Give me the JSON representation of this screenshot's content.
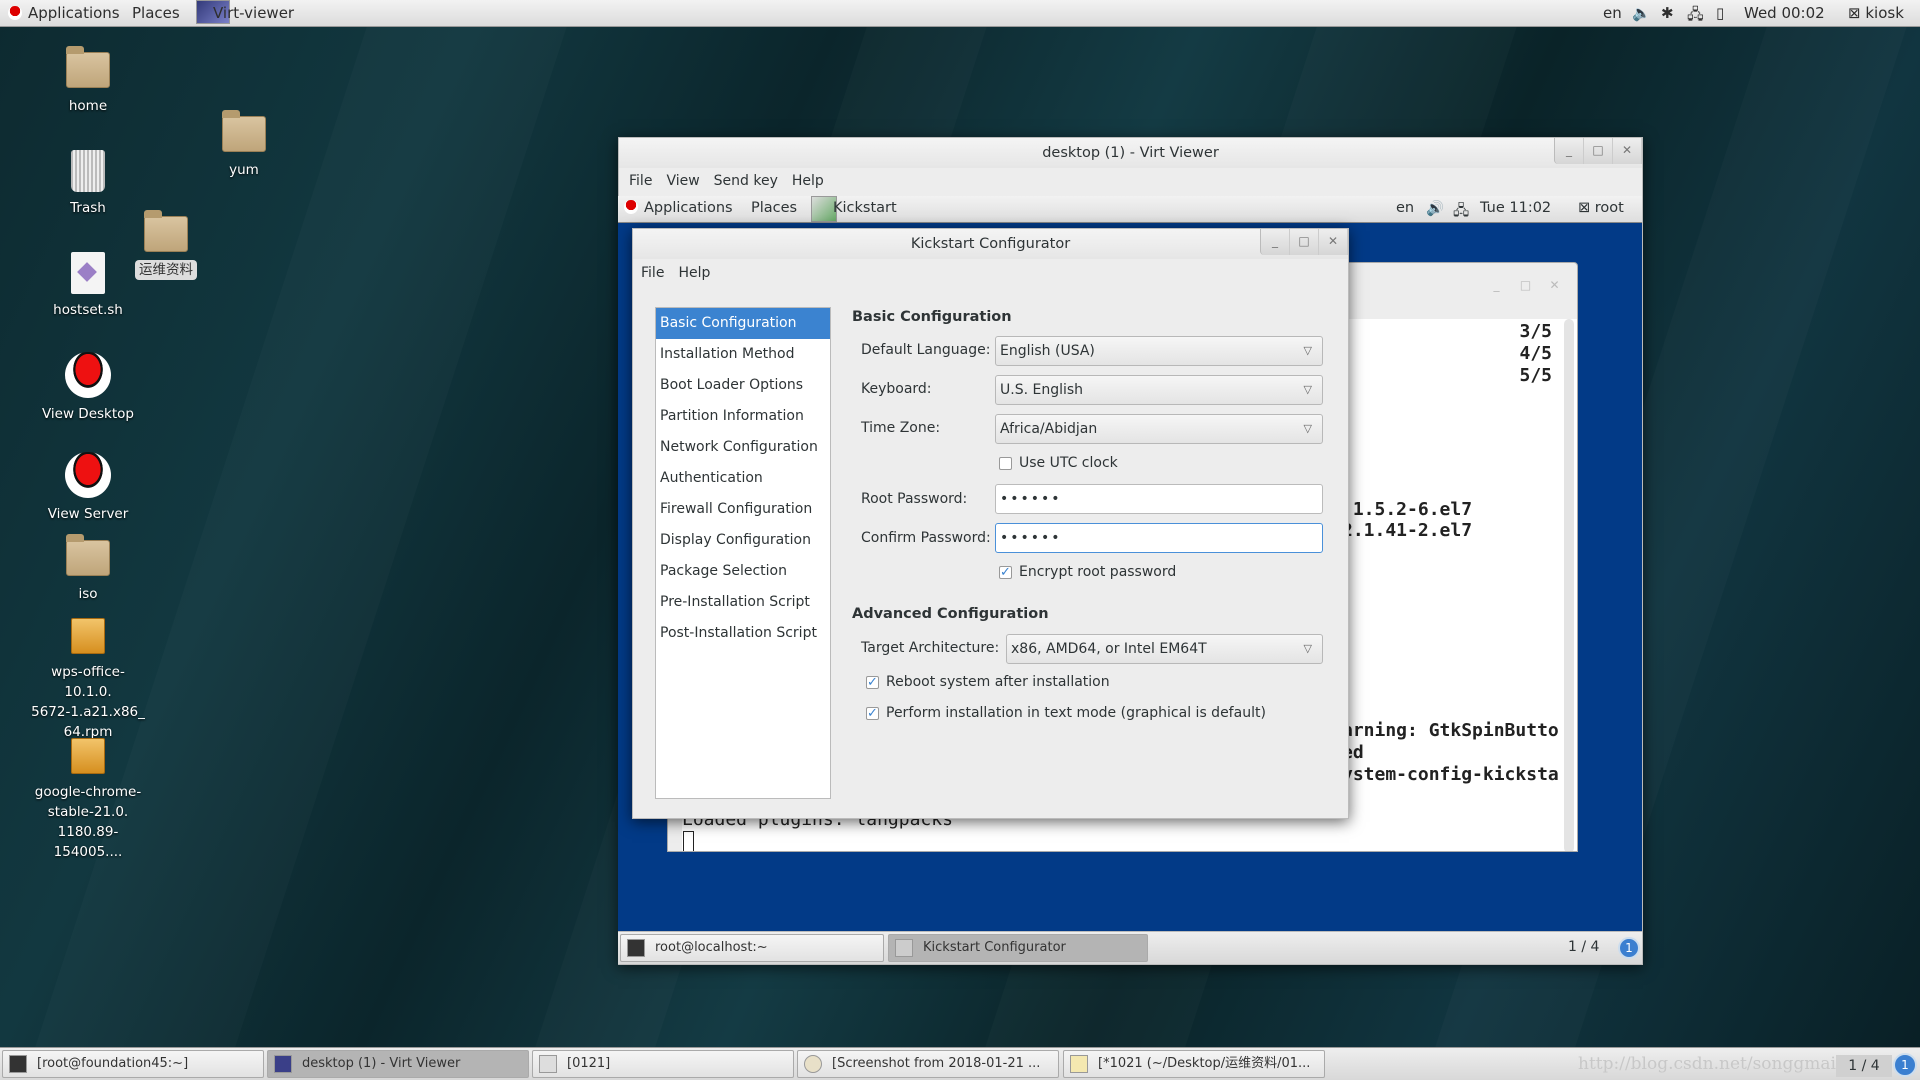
{
  "top_panel": {
    "applications": "Applications",
    "places": "Places",
    "app": "Virt-viewer",
    "lang": "en",
    "clock": "Wed 00:02",
    "user": "kiosk"
  },
  "desktop_icons": [
    {
      "label": "home",
      "type": "home-folder"
    },
    {
      "label": "Trash",
      "type": "trash"
    },
    {
      "label": "hostset.sh",
      "type": "script"
    },
    {
      "label": "View Desktop",
      "type": "redhat"
    },
    {
      "label": "View Server",
      "type": "redhat"
    },
    {
      "label": "iso",
      "type": "locked-folder"
    },
    {
      "label": "wps-office-10.1.0.\n5672-1.a21.x86_\n64.rpm",
      "type": "package"
    },
    {
      "label": "google-chrome-\nstable-21.0.\n1180.89-154005....",
      "type": "package"
    },
    {
      "label": "yum",
      "type": "folder"
    },
    {
      "label": "运维资料",
      "type": "folder"
    }
  ],
  "virt_viewer": {
    "title": "desktop (1) - Virt Viewer",
    "menu": [
      "File",
      "View",
      "Send key",
      "Help"
    ]
  },
  "guest_panel": {
    "applications": "Applications",
    "places": "Places",
    "app": "Kickstart",
    "lang": "en",
    "clock": "Tue 11:02",
    "user": "root"
  },
  "terminal": {
    "lines_right": [
      "3/5",
      "4/5",
      "5/5"
    ],
    "fragments": [
      ":1.5.2-6.el7",
      "2.1.41-2.el7",
      "arning: GtkSpinButto",
      "ed",
      "ystem-config-kicksta"
    ],
    "last_line": "Loaded plugins: langpacks"
  },
  "kickstart": {
    "title": "Kickstart Configurator",
    "menu": [
      "File",
      "Help"
    ],
    "sections": [
      "Basic Configuration",
      "Installation Method",
      "Boot Loader Options",
      "Partition Information",
      "Network Configuration",
      "Authentication",
      "Firewall Configuration",
      "Display Configuration",
      "Package Selection",
      "Pre-Installation Script",
      "Post-Installation Script"
    ],
    "selected_section": "Basic Configuration",
    "basic_header": "Basic Configuration",
    "default_language_label": "Default Language:",
    "default_language": "English (USA)",
    "keyboard_label": "Keyboard:",
    "keyboard": "U.S. English",
    "time_zone_label": "Time Zone:",
    "time_zone": "Africa/Abidjan",
    "utc_label": "Use UTC clock",
    "utc_checked": false,
    "root_password_label": "Root Password:",
    "root_password": "••••••",
    "confirm_password_label": "Confirm Password:",
    "confirm_password": "••••••",
    "encrypt_label": "Encrypt root password",
    "encrypt_checked": true,
    "advanced_header": "Advanced Configuration",
    "target_arch_label": "Target Architecture:",
    "target_arch": "x86, AMD64, or Intel EM64T",
    "reboot_label": "Reboot system after installation",
    "reboot_checked": true,
    "text_mode_label": "Perform installation in text mode (graphical is default)",
    "text_mode_checked": true
  },
  "guest_taskbar": {
    "items": [
      "root@localhost:~",
      "Kickstart Configurator"
    ],
    "workspace": "1 / 4",
    "notifications": "1"
  },
  "taskbar": {
    "items": [
      "[root@foundation45:~]",
      "desktop (1) - Virt Viewer",
      "[0121]",
      "[Screenshot from 2018-01-21 ...",
      "[*1021 (~/Desktop/运维资料/01..."
    ],
    "watermark": "http://blog.csdn.net/songgmail",
    "workspace": "1 / 4",
    "notifications": "1"
  }
}
